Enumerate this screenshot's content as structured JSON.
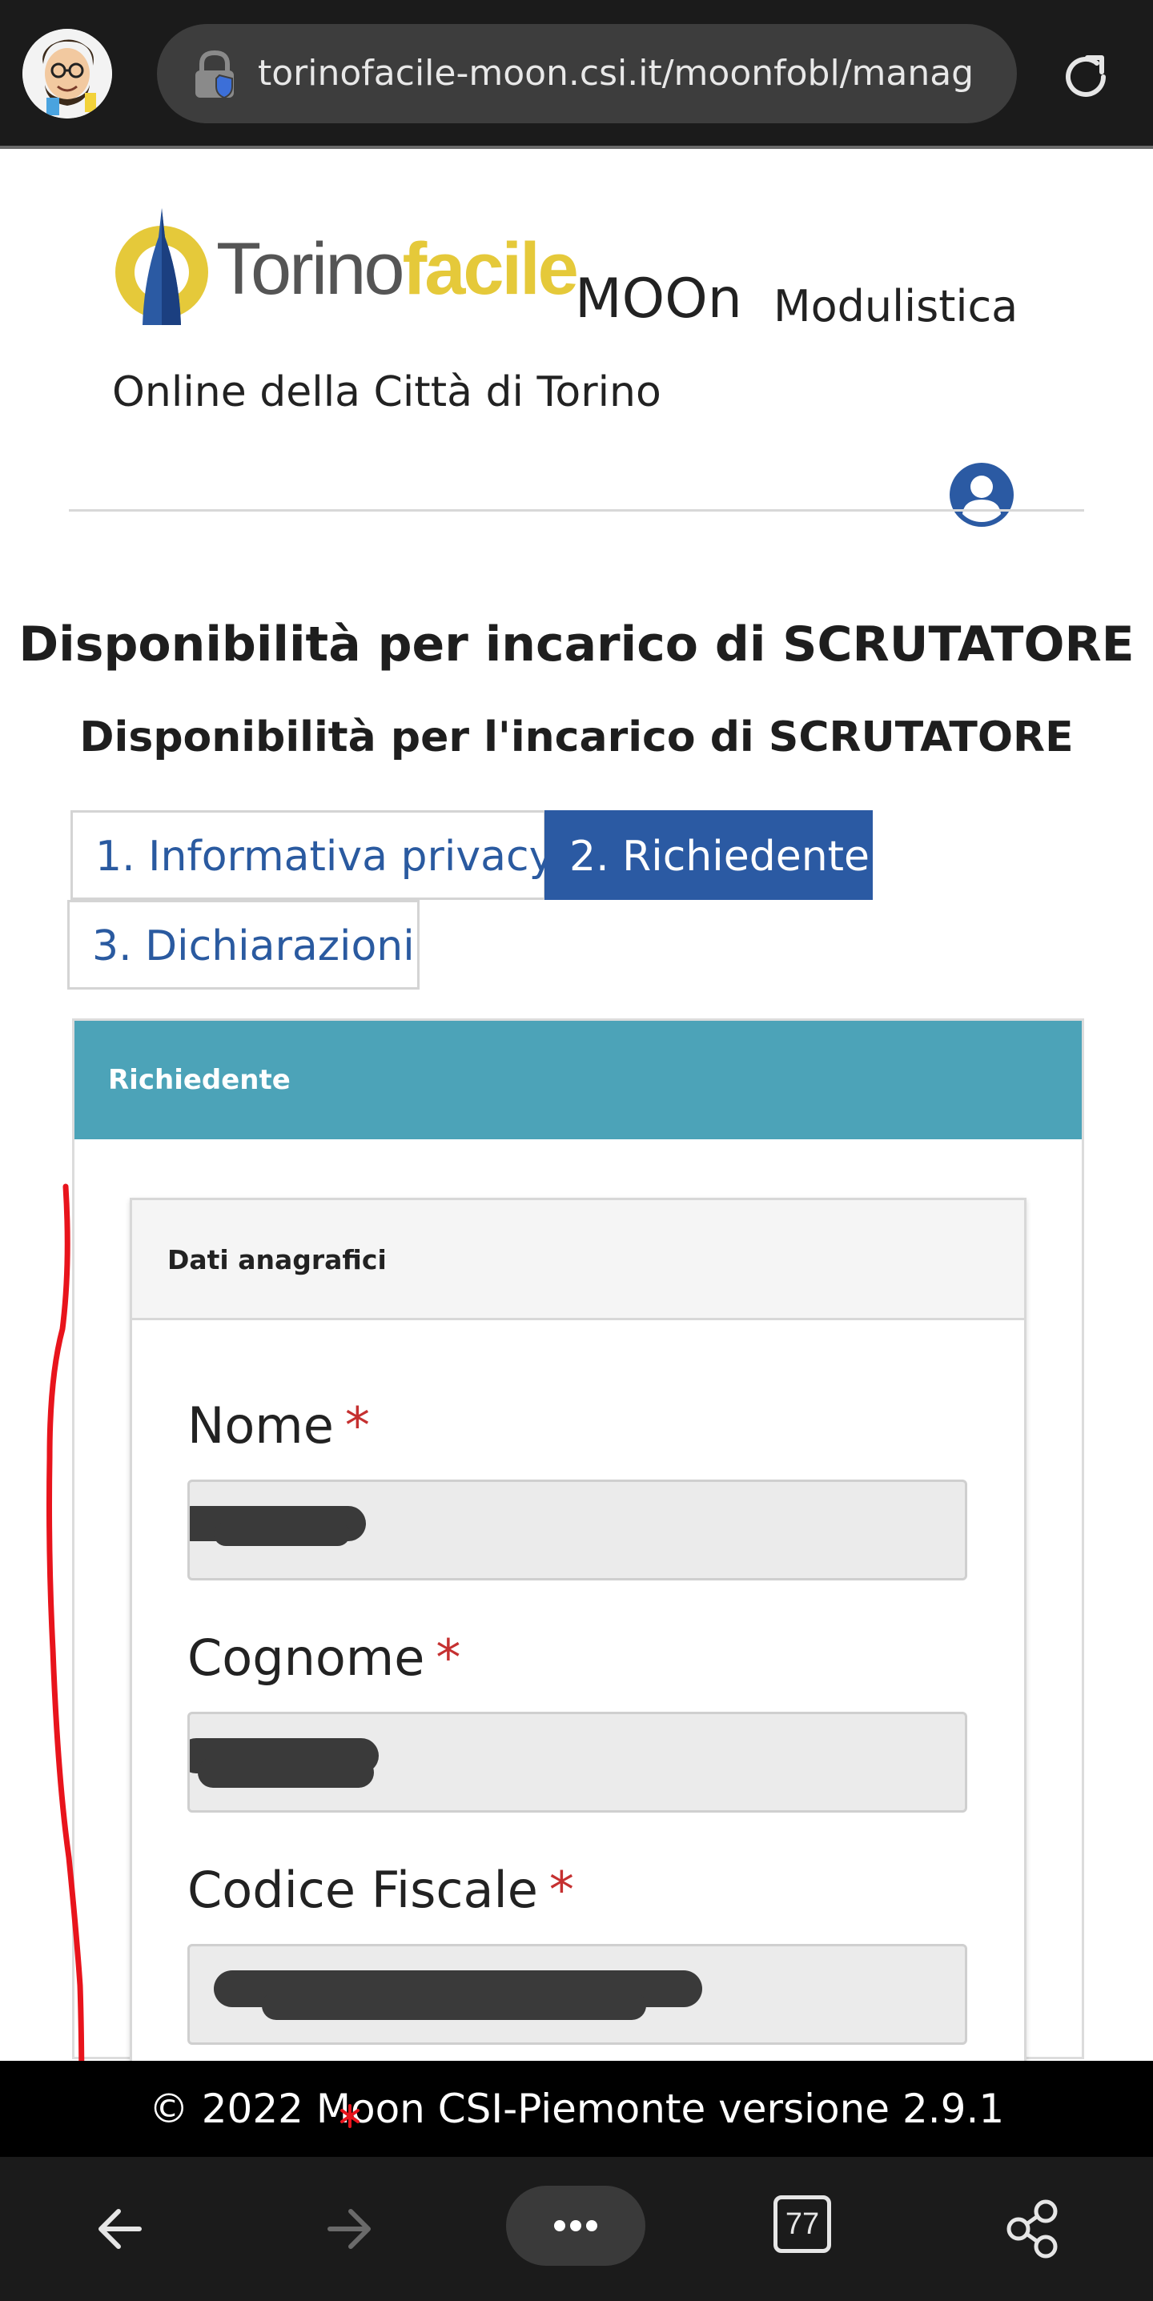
{
  "browser": {
    "url": "torinofacile-moon.csi.it/moonfobl/manag",
    "tab_count": "77",
    "icons": {
      "profile": "avatar-icon",
      "lock": "lock-shield-icon",
      "reload": "reload-icon",
      "back": "arrow-left-icon",
      "forward": "arrow-right-icon",
      "menu": "more-icon",
      "tabs": "tabs-icon",
      "share": "share-icon"
    }
  },
  "header": {
    "logo_part1": "Torino",
    "logo_part2": "facile",
    "app_name": "MOOn",
    "tagline_part1": "Modulistica",
    "tagline_part2": "Online della Città di Torino",
    "user_icon": "user-circle-icon"
  },
  "page": {
    "title": "Disponibilità per incarico di SCRUTATORE",
    "subtitle": "Disponibilità per l'incarico di SCRUTATORE"
  },
  "tabs": [
    {
      "label": "1. Informativa privacy",
      "active": false
    },
    {
      "label": "2. Richiedente",
      "active": true
    },
    {
      "label": "3. Dichiarazioni",
      "active": false
    }
  ],
  "form": {
    "panel_title": "Richiedente",
    "section_title": "Dati anagrafici",
    "required_mark": "*",
    "fields": [
      {
        "label": "Nome",
        "value": ""
      },
      {
        "label": "Cognome",
        "value": ""
      },
      {
        "label": "Codice Fiscale",
        "value": ""
      }
    ]
  },
  "footer": {
    "text": "© 2022 Moon CSI-Piemonte versione 2.9.1"
  },
  "colors": {
    "active_tab": "#2b5aa3",
    "panel_header": "#4ca3b8",
    "required": "#c53030",
    "logo_yellow": "#e5c93a",
    "annotation": "#e8141c"
  }
}
